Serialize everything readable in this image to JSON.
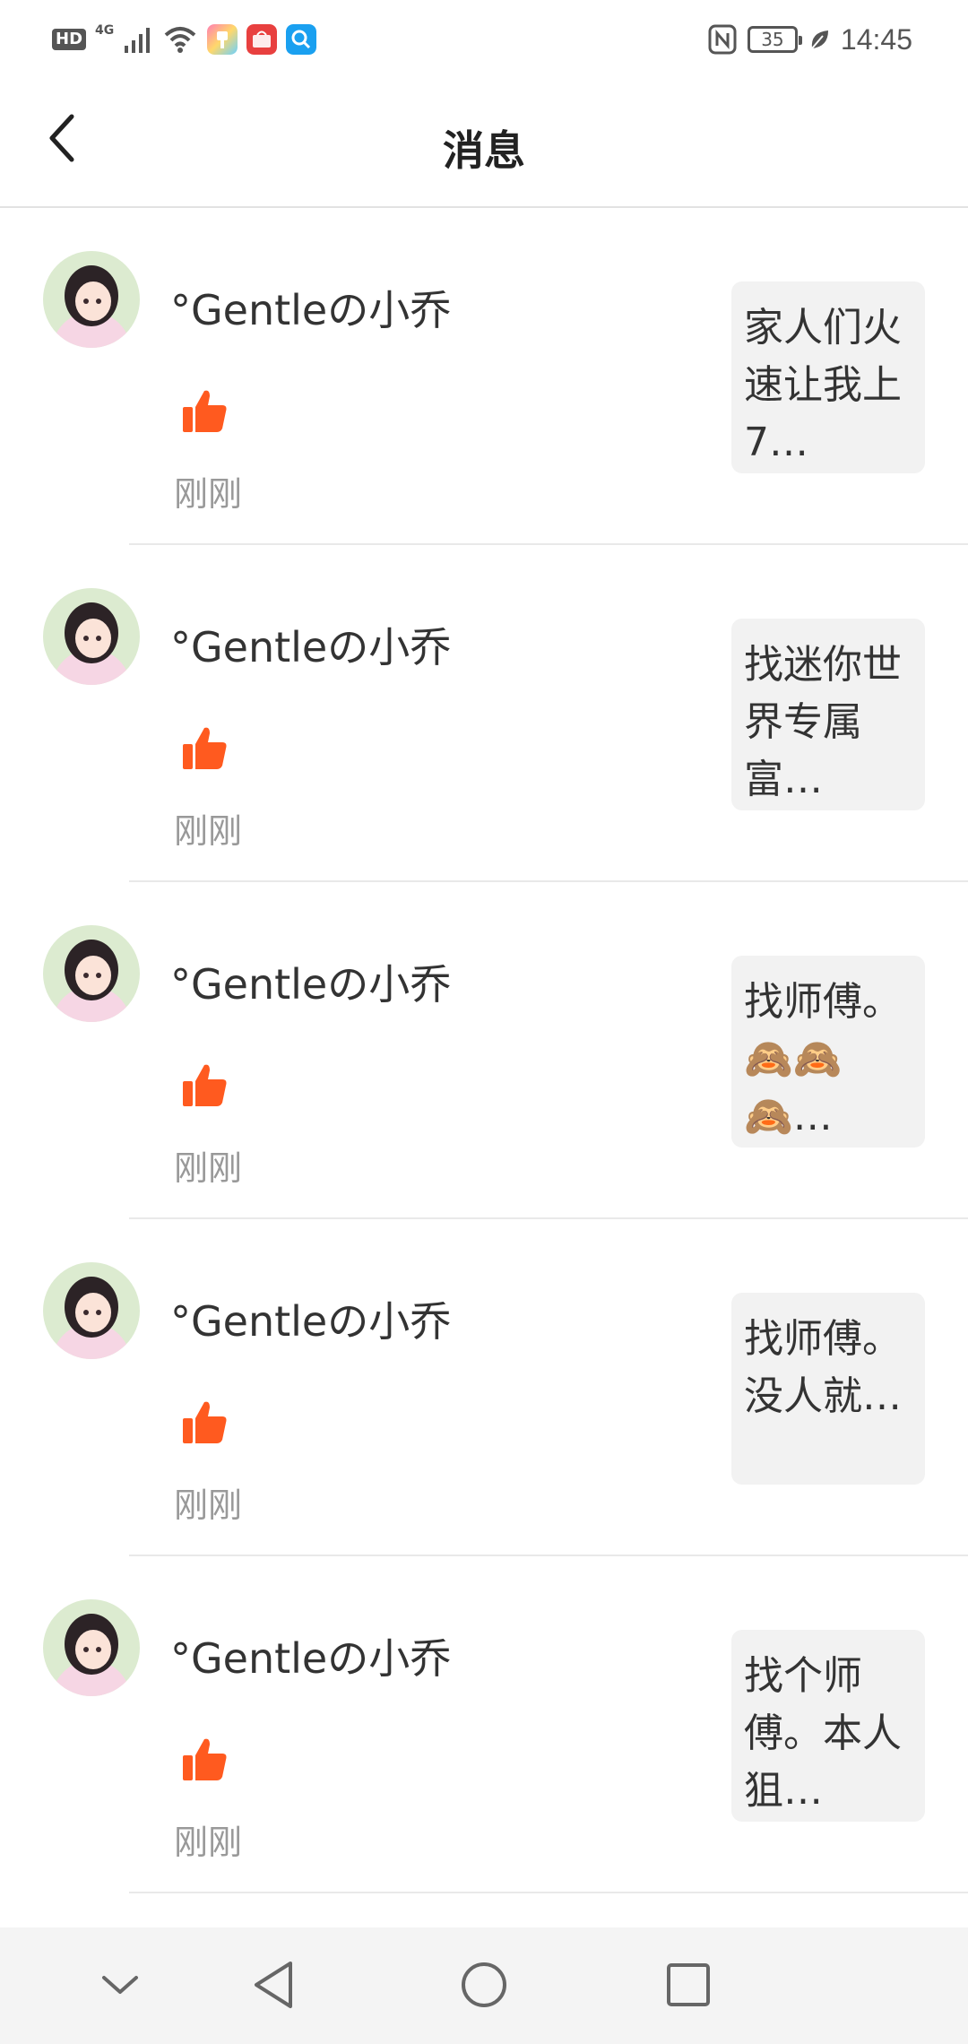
{
  "status_bar": {
    "left_icons": [
      "hd-badge",
      "signal-4g-icon",
      "wifi-icon",
      "app-theme-icon",
      "app-huawei-icon",
      "app-search-icon"
    ],
    "hd_label": "HD",
    "network_label": "4G",
    "battery_level": "35",
    "time": "14:45"
  },
  "header": {
    "title": "消息",
    "back_icon": "chevron-left-icon"
  },
  "messages": [
    {
      "username": "°Gentleの小乔",
      "time": "刚刚",
      "preview": "家人们火速让我上7…"
    },
    {
      "username": "°Gentleの小乔",
      "time": "刚刚",
      "preview": "找迷你世界专属富…"
    },
    {
      "username": "°Gentleの小乔",
      "time": "刚刚",
      "preview": "找师傅。🙈🙈🙈…"
    },
    {
      "username": "°Gentleの小乔",
      "time": "刚刚",
      "preview": "找师傅。没人就…"
    },
    {
      "username": "°Gentleの小乔",
      "time": "刚刚",
      "preview": "找个师傅。本人狙…"
    }
  ],
  "colors": {
    "like": "#ff5a1f",
    "divider": "#e9e9e9",
    "preview_bg": "#f2f2f2",
    "nav_bg": "#f4f4f4"
  },
  "nav_bar": {
    "buttons": [
      "chevron-down-icon",
      "back-triangle-icon",
      "home-circle-icon",
      "recents-square-icon"
    ]
  }
}
